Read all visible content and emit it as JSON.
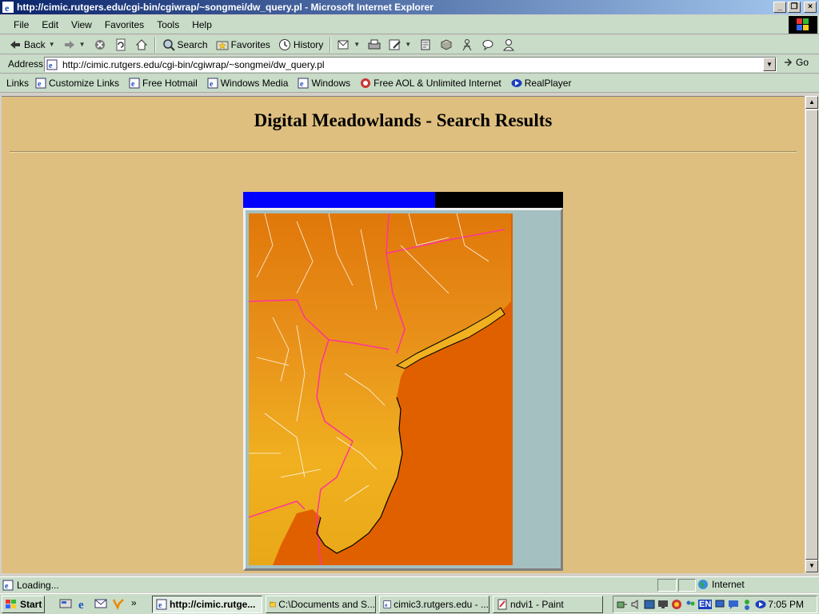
{
  "window": {
    "title": "http://cimic.rutgers.edu/cgi-bin/cgiwrap/~songmei/dw_query.pl - Microsoft Internet Explorer",
    "minimize": "_",
    "maximize": "❐",
    "close": "×"
  },
  "menu": [
    "File",
    "Edit",
    "View",
    "Favorites",
    "Tools",
    "Help"
  ],
  "toolbar": {
    "back": "Back",
    "search": "Search",
    "favorites": "Favorites",
    "history": "History"
  },
  "address": {
    "label": "Address",
    "url": "http://cimic.rutgers.edu/cgi-bin/cgiwrap/~songmei/dw_query.pl",
    "go": "Go"
  },
  "links": {
    "label": "Links",
    "items": [
      "Customize Links",
      "Free Hotmail",
      "Windows Media",
      "Windows",
      "Free AOL & Unlimited Internet",
      "RealPlayer"
    ]
  },
  "page": {
    "title": "Digital Meadowlands - Search Results",
    "progress_fraction": 0.6
  },
  "status": {
    "text": "Loading...",
    "zone": "Internet"
  },
  "taskbar": {
    "start": "Start",
    "tasks": [
      "http://cimic.rutge...",
      "C:\\Documents and S...",
      "cimic3.rutgers.edu - ...",
      "ndvi1 - Paint"
    ],
    "clock": "7:05 PM",
    "language": "EN"
  },
  "colors": {
    "page_bg": "#dfbf7f",
    "progress_fill": "#0000ff",
    "map_ocean": "#e06000",
    "map_land": "#e8a020",
    "state_border": "#ff3399"
  }
}
